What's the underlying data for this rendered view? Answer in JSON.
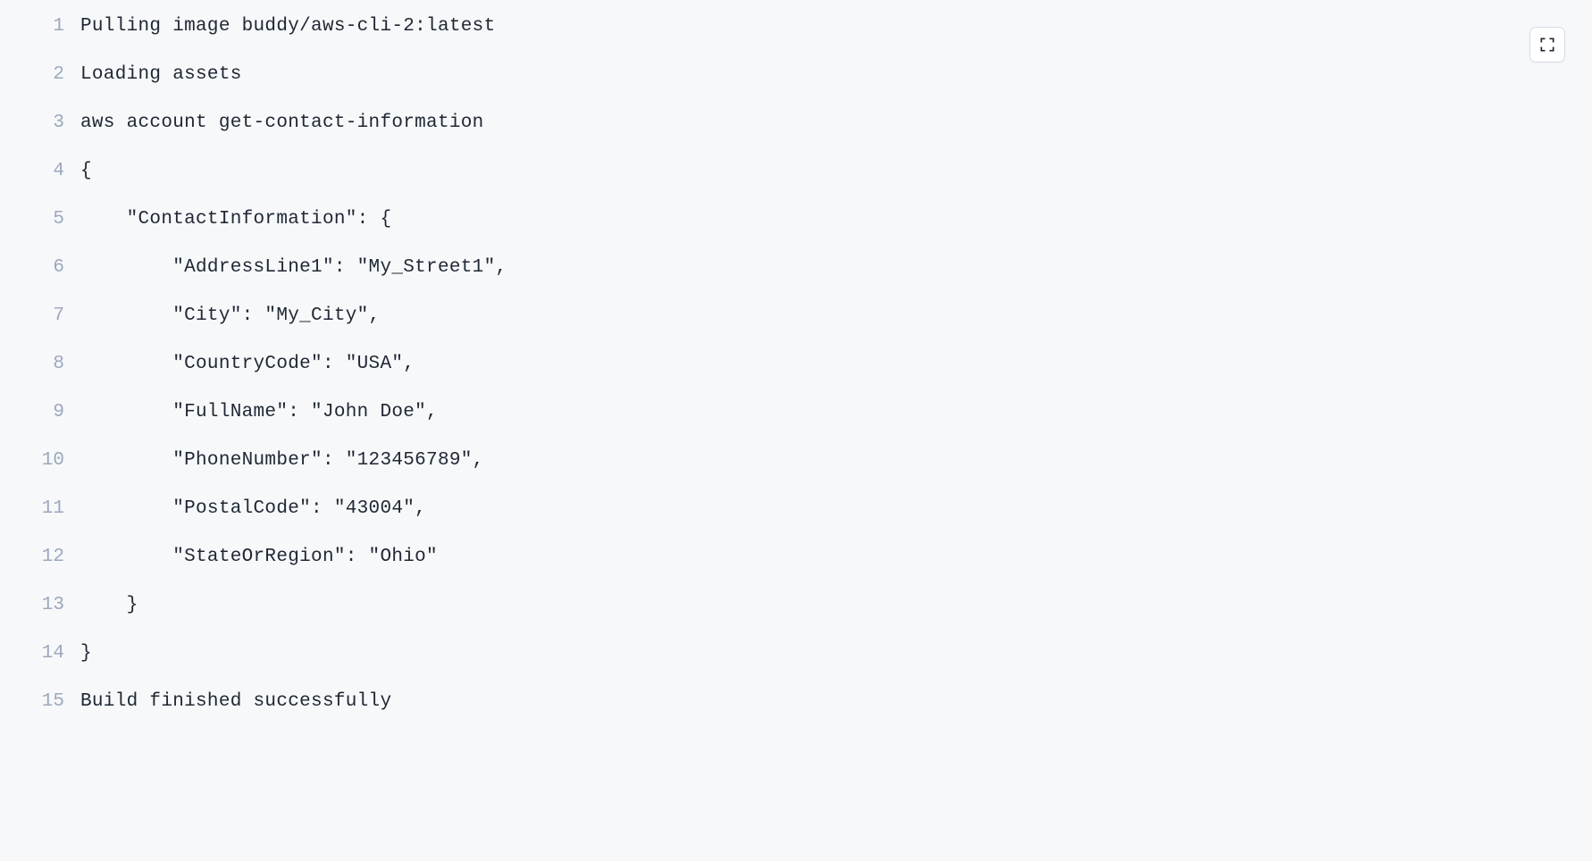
{
  "lines": [
    {
      "number": "1",
      "content": "Pulling image buddy/aws-cli-2:latest"
    },
    {
      "number": "2",
      "content": "Loading assets"
    },
    {
      "number": "3",
      "content": "aws account get-contact-information"
    },
    {
      "number": "4",
      "content": "{"
    },
    {
      "number": "5",
      "content": "    \"ContactInformation\": {"
    },
    {
      "number": "6",
      "content": "        \"AddressLine1\": \"My_Street1\","
    },
    {
      "number": "7",
      "content": "        \"City\": \"My_City\","
    },
    {
      "number": "8",
      "content": "        \"CountryCode\": \"USA\","
    },
    {
      "number": "9",
      "content": "        \"FullName\": \"John Doe\","
    },
    {
      "number": "10",
      "content": "        \"PhoneNumber\": \"123456789\","
    },
    {
      "number": "11",
      "content": "        \"PostalCode\": \"43004\","
    },
    {
      "number": "12",
      "content": "        \"StateOrRegion\": \"Ohio\""
    },
    {
      "number": "13",
      "content": "    }"
    },
    {
      "number": "14",
      "content": "}"
    },
    {
      "number": "15",
      "content": "Build finished successfully"
    }
  ]
}
